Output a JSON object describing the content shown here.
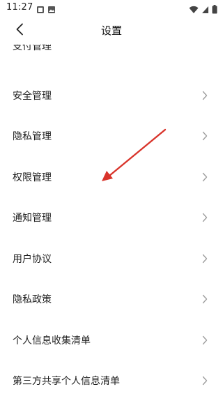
{
  "status_bar": {
    "time": "11:27",
    "left_icons": [
      "gallery-notification-icon",
      "image-notification-icon"
    ],
    "right_icons": [
      "wifi-icon",
      "signal-icon",
      "battery-icon"
    ]
  },
  "header": {
    "title": "设置",
    "back_icon": "chevron-left-icon"
  },
  "settings_items": [
    {
      "label": "支付管理",
      "partially_visible": true
    },
    {
      "label": "安全管理"
    },
    {
      "label": "隐私管理"
    },
    {
      "label": "权限管理"
    },
    {
      "label": "通知管理"
    },
    {
      "label": "用户协议"
    },
    {
      "label": "隐私政策"
    },
    {
      "label": "个人信息收集清单"
    },
    {
      "label": "第三方共享个人信息清单"
    }
  ],
  "annotation": {
    "type": "red-arrow",
    "color": "#d9342b",
    "points_to": "权限管理"
  },
  "colors": {
    "chevron": "#9e9e9e",
    "text": "#1f1f1f",
    "background": "#ffffff"
  }
}
